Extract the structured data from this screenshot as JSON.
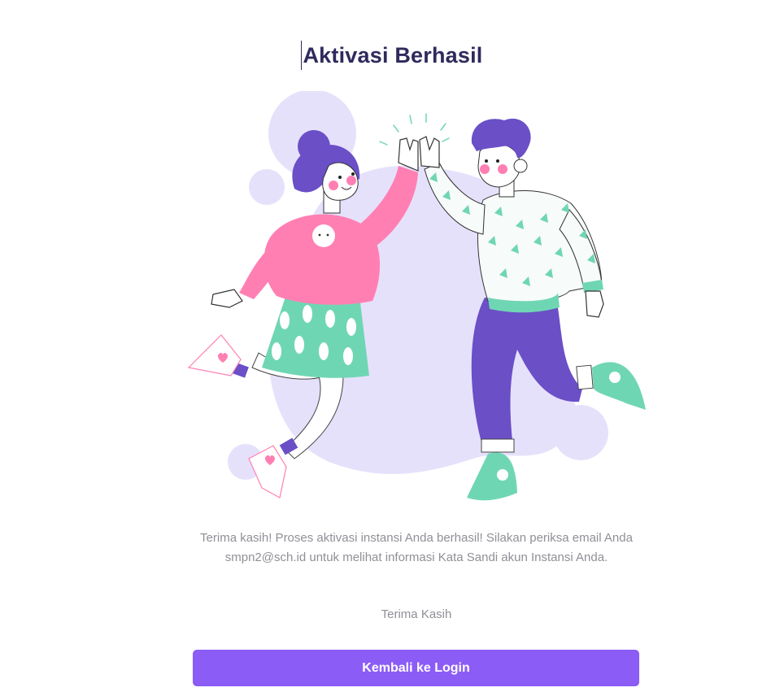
{
  "page": {
    "title": "Aktivasi Berhasil",
    "message": "Terima kasih! Proses aktivasi instansi Anda berhasil! Silakan periksa email Anda smpn2@sch.id untuk melihat informasi Kata Sandi akun Instansi Anda.",
    "closing": "Terima Kasih",
    "button_label": "Kembali ke Login"
  },
  "illustration": {
    "name": "high-five-illustration"
  },
  "colors": {
    "title": "#2f2a5c",
    "text_muted": "#8f8f97",
    "button": "#8b5cf6",
    "blob": "#e6e1fb",
    "pink": "#ff7fb3",
    "purple": "#6a4fc7",
    "green": "#6fd6b4"
  }
}
